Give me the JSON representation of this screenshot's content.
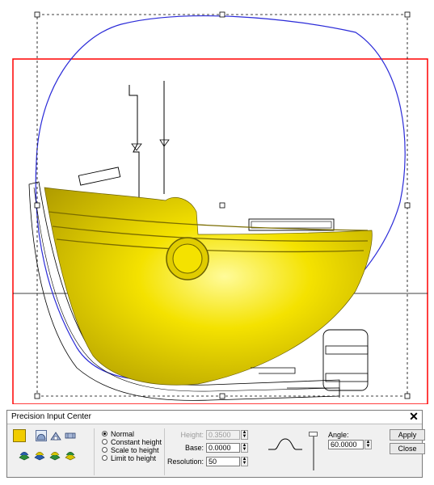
{
  "panel": {
    "title": "Precision Input Center",
    "close_glyph": "✕",
    "color_swatch": "#f1cc00",
    "icons_row1": [
      "dome-profile-icon",
      "arch-profile-icon",
      "flat-profile-icon"
    ],
    "icons_row2": [
      "layer-add-icon",
      "layer-blend-icon",
      "layer-merge-icon",
      "layer-replace-icon"
    ],
    "options": [
      {
        "label": "Normal",
        "selected": true
      },
      {
        "label": "Constant height",
        "selected": false
      },
      {
        "label": "Scale to height",
        "selected": false
      },
      {
        "label": "Limit to height",
        "selected": false
      }
    ],
    "height_label": "Height:",
    "height_value": "0.3500",
    "base_label": "Base:",
    "base_value": "0.0000",
    "resolution_label": "Resolution:",
    "resolution_value": "50",
    "angle_label": "Angle:",
    "angle_value": "60.0000",
    "apply_label": "Apply",
    "close_label": "Close"
  },
  "colors": {
    "selection_red": "#ff0000",
    "blue_vector": "#2b2bd8",
    "hull_yellow": "#f2dd00"
  }
}
